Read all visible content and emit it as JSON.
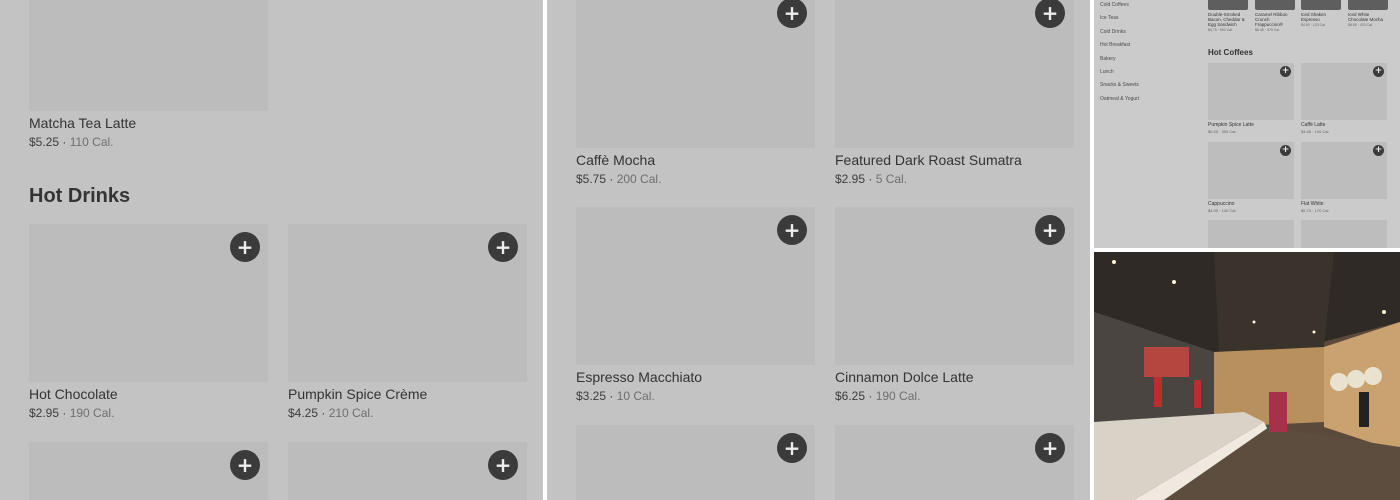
{
  "panel1": {
    "top_item": {
      "name": "Matcha Tea Latte",
      "price": "$5.25",
      "cal": "110 Cal."
    },
    "section_title": "Hot Drinks",
    "items": [
      {
        "name": "Hot Chocolate",
        "price": "$2.95",
        "cal": "190 Cal."
      },
      {
        "name": "Pumpkin Spice Crème",
        "price": "$4.25",
        "cal": "210 Cal."
      }
    ]
  },
  "panel2": {
    "items": [
      {
        "name": "Caffè Mocha",
        "price": "$5.75",
        "cal": "200 Cal."
      },
      {
        "name": "Featured Dark Roast Sumatra",
        "price": "$2.95",
        "cal": "5 Cal."
      },
      {
        "name": "Espresso Macchiato",
        "price": "$3.25",
        "cal": "10 Cal."
      },
      {
        "name": "Cinnamon Dolce Latte",
        "price": "$6.25",
        "cal": "190 Cal."
      }
    ]
  },
  "panel3": {
    "sidebar": [
      "Cold Coffees",
      "Ice Teas",
      "Cold Drinks",
      "Hot Breakfast",
      "Bakery",
      "Lunch",
      "Snacks & Sweets",
      "Oatmeal & Yogurt"
    ],
    "top_items": [
      {
        "name": "Double-Smoked Bacon, Cheddar & Egg Sandwich",
        "meta": "$6.75 · 500 Cal."
      },
      {
        "name": "Caramel Ribbon Crunch Frappuccino®",
        "meta": "$6.45 · 470 Cal."
      },
      {
        "name": "Iced Shaken Espresso",
        "meta": "$4.50 · 120 Cal."
      },
      {
        "name": "Iced White Chocolate Mocha",
        "meta": "$6.65 · 420 Cal."
      }
    ],
    "section_title": "Hot Coffees",
    "items": [
      {
        "name": "Pumpkin Spice Latte",
        "meta": "$6.55 · 390 Cal."
      },
      {
        "name": "Caffè Latte",
        "meta": "$4.65 · 190 Cal."
      },
      {
        "name": "Cappuccino",
        "meta": "$4.95 · 140 Cal."
      },
      {
        "name": "Flat White",
        "meta": "$5.75 · 170 Cal."
      }
    ]
  },
  "plus_glyph": "+",
  "colors": {
    "overlay": "#c3c3c3",
    "plus_button": "#3b3b3b",
    "placeholder": "#bcbcbc"
  }
}
